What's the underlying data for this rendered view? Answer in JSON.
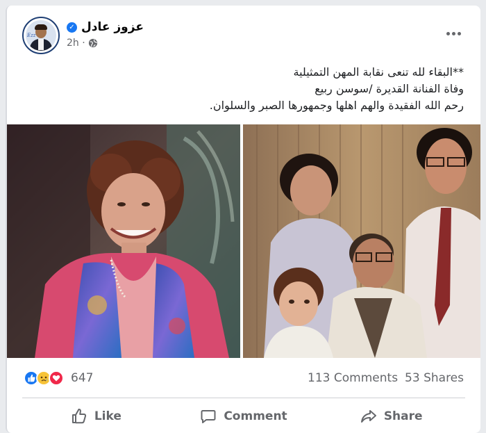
{
  "post": {
    "author": "عزوز عادل",
    "time": "2h ·",
    "verified_mark": "✓",
    "text_lines": [
      "**البقاء لله تنعى نقابة المهن التمثيلية",
      "وفاة الفنانة القديرة /سوسن ربيع",
      "رحم الله الفقيدة والهم اهلها وجمهورها الصبر والسلوان."
    ],
    "avatar_text": "Ezz"
  },
  "engagement": {
    "reaction_count": "647",
    "comments": "113 Comments",
    "shares": "53 Shares",
    "reaction_icons": [
      "like-icon",
      "sad-icon",
      "love-icon"
    ]
  },
  "actions": {
    "like": "Like",
    "comment": "Comment",
    "share": "Share"
  },
  "colors": {
    "like_blue": "#1877f2",
    "sad_yellow": "#f7c338",
    "love_red": "#f0284a",
    "muted_text": "#65676b"
  }
}
